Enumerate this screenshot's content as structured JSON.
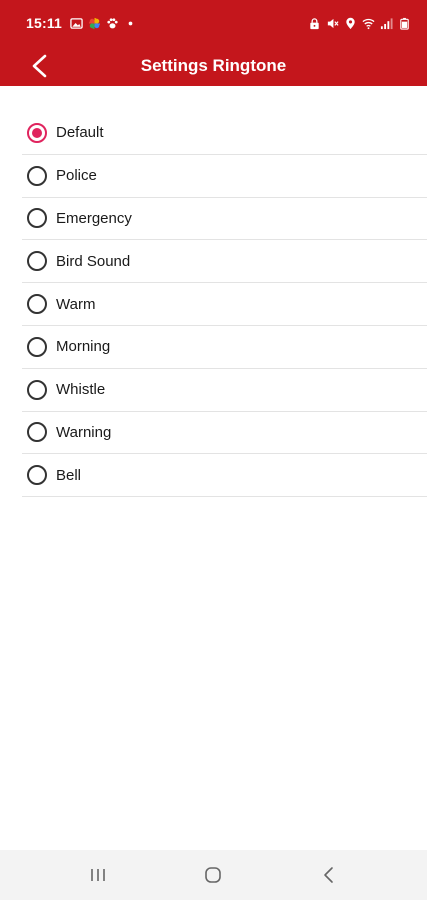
{
  "status_bar": {
    "time": "15:11",
    "left_icons": [
      "gallery-icon",
      "photos-pinwheel-icon",
      "paw-icon",
      "dot-icon"
    ],
    "right_icons": [
      "lock-icon",
      "mute-icon",
      "location-icon",
      "wifi-icon",
      "signal-icon",
      "battery-icon"
    ]
  },
  "app_bar": {
    "title": "Settings Ringtone",
    "back_icon": "back-chevron-icon",
    "background": "#c4161c"
  },
  "ringtones": [
    {
      "label": "Default",
      "selected": true
    },
    {
      "label": "Police",
      "selected": false
    },
    {
      "label": "Emergency",
      "selected": false
    },
    {
      "label": "Bird Sound",
      "selected": false
    },
    {
      "label": "Warm",
      "selected": false
    },
    {
      "label": "Morning",
      "selected": false
    },
    {
      "label": "Whistle",
      "selected": false
    },
    {
      "label": "Warning",
      "selected": false
    },
    {
      "label": "Bell",
      "selected": false
    }
  ],
  "accent_color": "#e0245e",
  "nav_bar": {
    "buttons": [
      "recents-icon",
      "home-icon",
      "back-icon"
    ]
  }
}
